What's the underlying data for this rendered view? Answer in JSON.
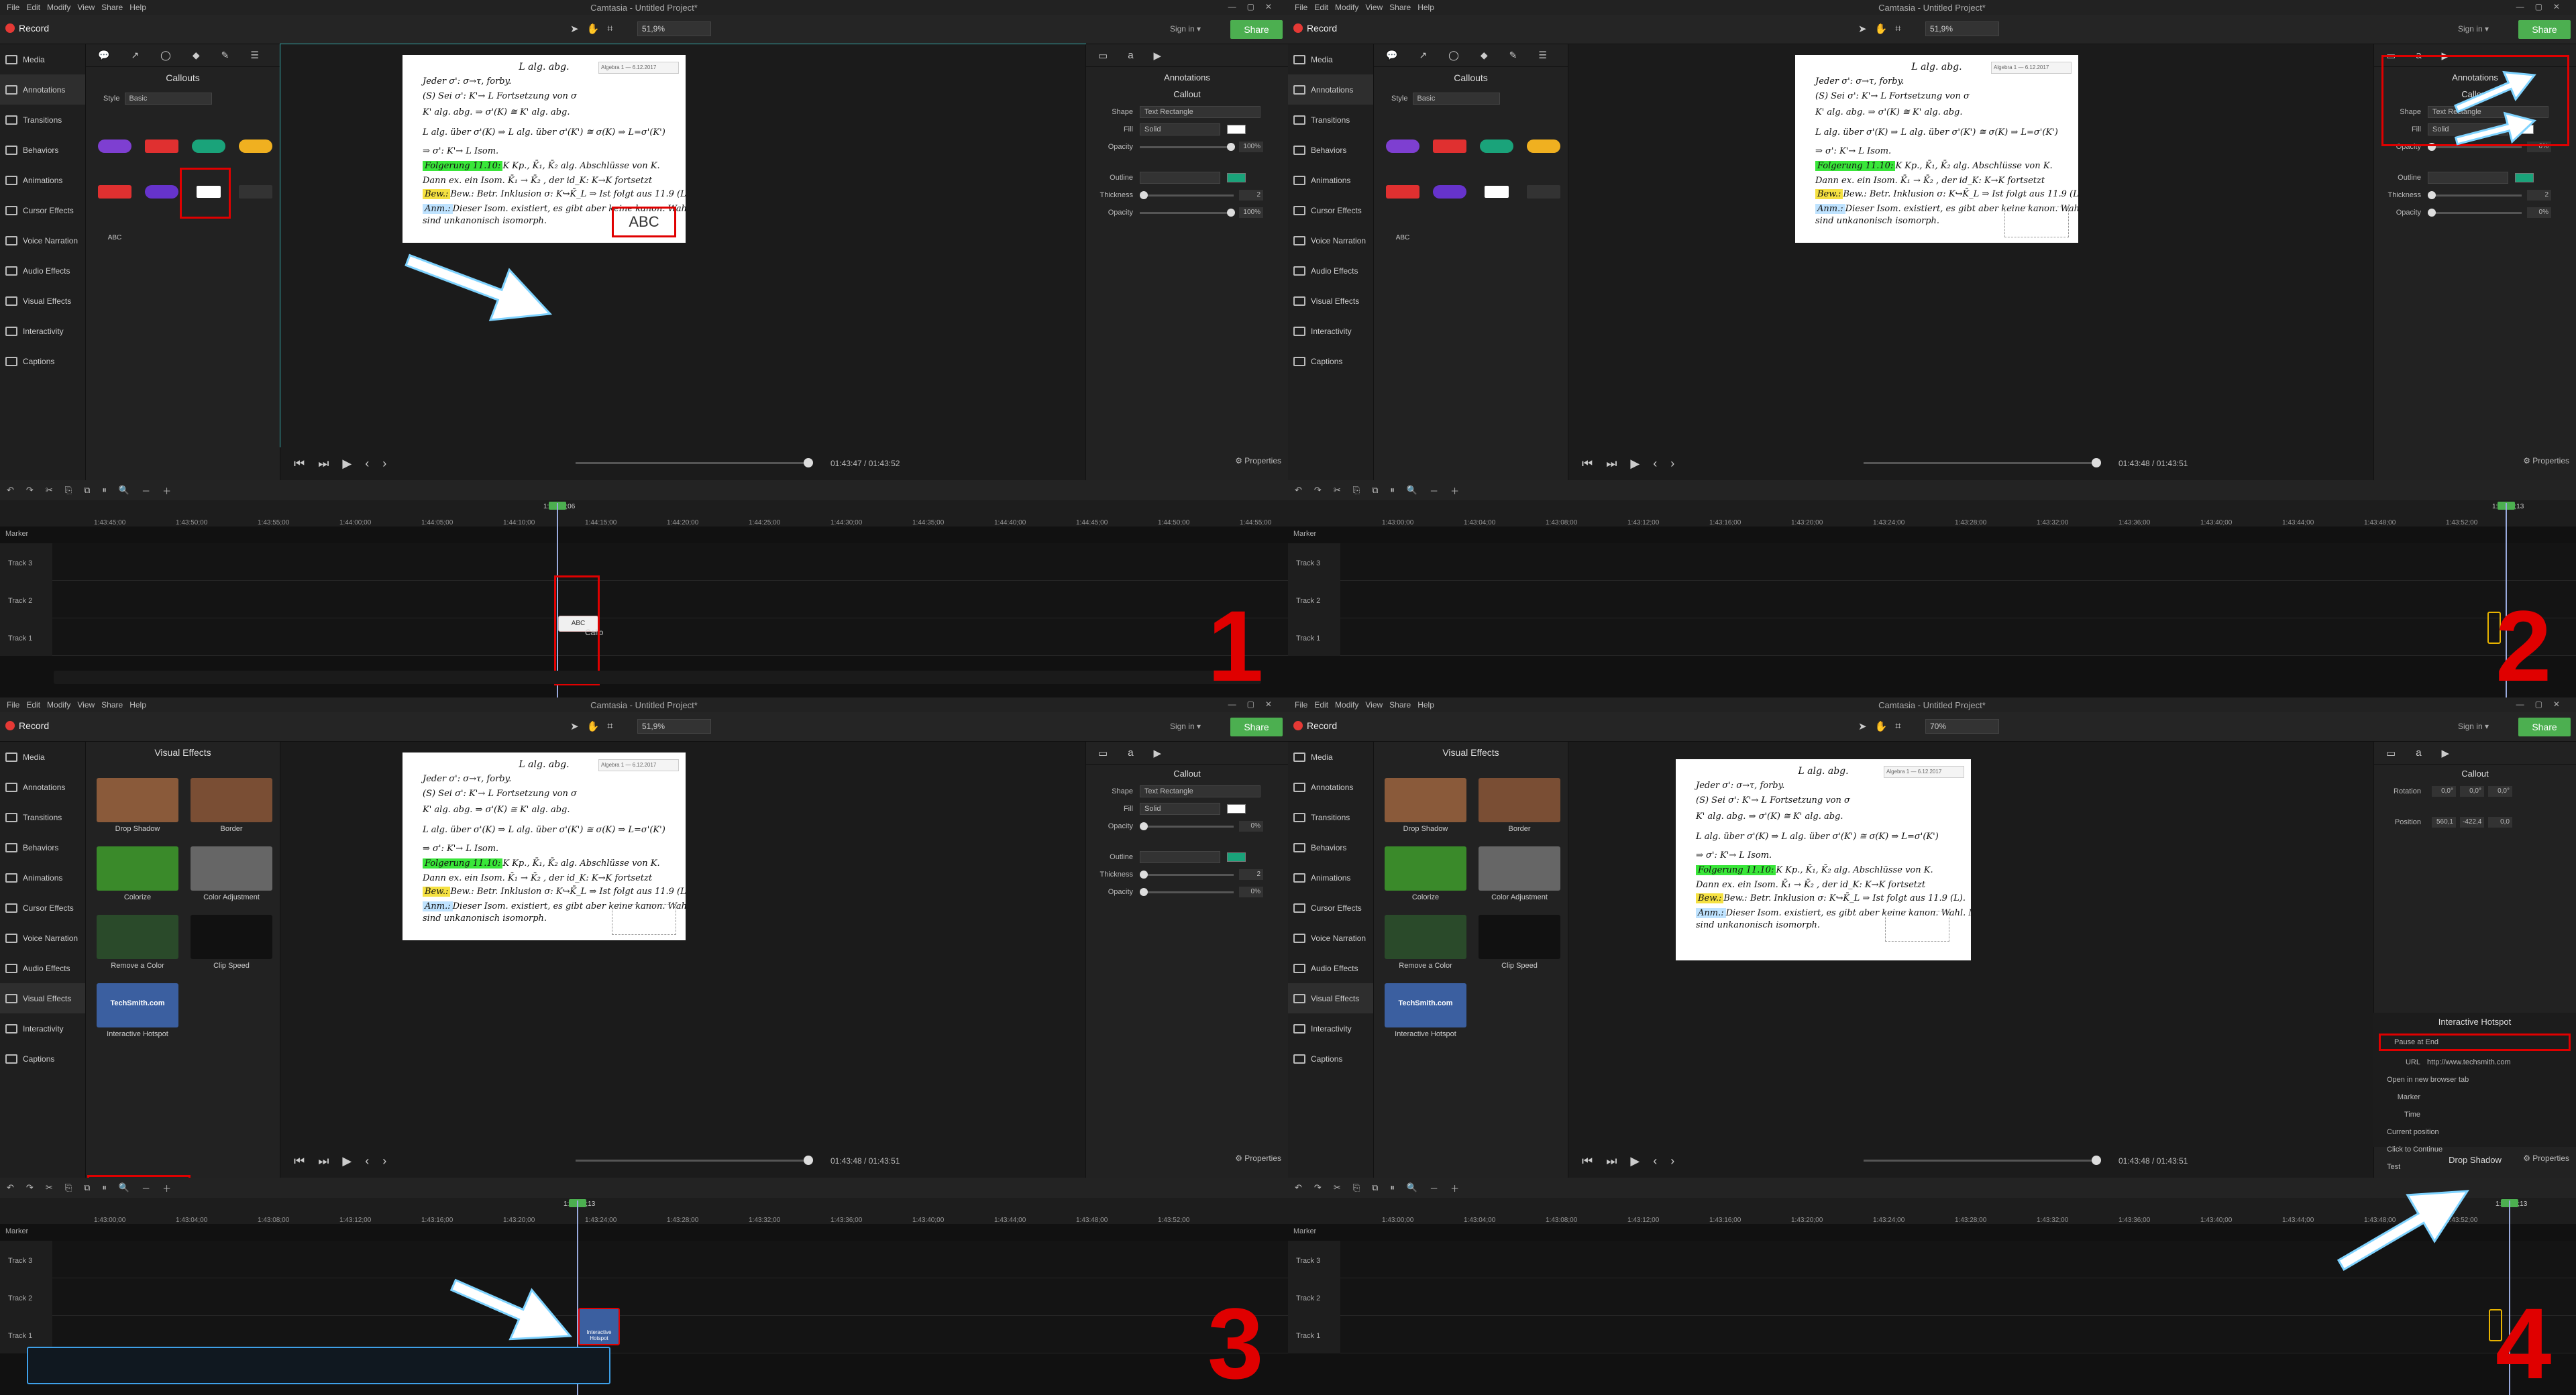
{
  "app": {
    "menu": [
      "File",
      "Edit",
      "Modify",
      "View",
      "Share",
      "Help"
    ],
    "title": "Camtasia - Untitled Project*",
    "record_label": "Record",
    "sign_in": "Sign in ▾",
    "share_label": "Share"
  },
  "sidebar_items": [
    "Media",
    "Annotations",
    "Transitions",
    "Behaviors",
    "Animations",
    "Cursor Effects",
    "Voice Narration",
    "Audio Effects",
    "Visual Effects",
    "Interactivity",
    "Captions"
  ],
  "quadrants": [
    {
      "number": "1",
      "zoom": "51,9%",
      "tray_title": "Callouts",
      "style_label": "Style",
      "style_value": "Basic",
      "props_header": "Annotations",
      "props_title": "Callout",
      "shape_label": "Shape",
      "shape_value": "Text Rectangle",
      "fill_label": "Fill",
      "fill_value": "Solid",
      "opacity_label": "Opacity",
      "opacity_value": "100%",
      "outline_label": "Outline",
      "thickness_label": "Thickness",
      "thickness_value": "2",
      "opacity2_value": "100%",
      "time": "01:43:47 / 01:43:52",
      "playhead": "1:43:47;06",
      "callout_text": "ABC",
      "track_clip_label": "Callo",
      "abc_canvas": "ABC"
    },
    {
      "number": "2",
      "zoom": "51,9%",
      "tray_title": "Callouts",
      "style_label": "Style",
      "style_value": "Basic",
      "props_header": "Annotations",
      "props_title": "Callout",
      "shape_label": "Shape",
      "shape_value": "Text Rectangle",
      "fill_label": "Fill",
      "fill_value": "Solid",
      "opacity_label": "Opacity",
      "opacity_value": "0%",
      "outline_label": "Outline",
      "thickness_label": "Thickness",
      "thickness_value": "2",
      "opacity2_value": "0%",
      "time": "01:43:48 / 01:43:51",
      "playhead": "1:43:48;13"
    },
    {
      "number": "3",
      "zoom": "51,9%",
      "tray_title": "Visual Effects",
      "props_title": "Callout",
      "shape_label": "Shape",
      "shape_value": "Text Rectangle",
      "fill_label": "Fill",
      "fill_value": "Solid",
      "opacity_label": "Opacity",
      "opacity_value": "0%",
      "outline_label": "Outline",
      "thickness_label": "Thickness",
      "thickness_value": "2",
      "opacity2_value": "0%",
      "time": "01:43:48 / 01:43:51",
      "playhead": "1:43:48;13",
      "hotspot_clip_label": "Interactive Hotspot"
    },
    {
      "number": "4",
      "zoom": "70%",
      "tray_title": "Visual Effects",
      "props_title": "Callout",
      "rotation_label": "Rotation",
      "position_label": "Position",
      "rot_values": [
        "0,0°",
        "0,0°",
        "0,0°"
      ],
      "pos_values": [
        "560,1",
        "-422,4",
        "0,0"
      ],
      "hotspot_title": "Interactive Hotspot",
      "pause_at_end": "Pause at End",
      "url_label": "URL",
      "url_value": "http://www.techsmith.com",
      "open_new_tab": "Open in new browser tab",
      "marker_label": "Marker",
      "time_label": "Time",
      "current_position": "Current position",
      "click_to_continue": "Click to Continue",
      "test_label": "Test",
      "drop_shadow": "Drop Shadow",
      "time": "01:43:48 / 01:43:51",
      "playhead": "1:43:48;13"
    }
  ],
  "callout_tray": {
    "abc_label": "ABC"
  },
  "visual_effects": [
    {
      "label": "Drop Shadow",
      "color": "#8a5a3a"
    },
    {
      "label": "Border",
      "color": "#7a4e34"
    },
    {
      "label": "Colorize",
      "color": "#3a8a2a"
    },
    {
      "label": "Color Adjustment",
      "color": "#666666"
    },
    {
      "label": "Remove a Color",
      "color": "#2a4a2a"
    },
    {
      "label": "Clip Speed",
      "color": "#eeeeee"
    },
    {
      "label": "Interactive Hotspot",
      "color": "#3b5fa0"
    }
  ],
  "hotspot_thumb_text": "TechSmith.com",
  "document": {
    "head": "L alg. abg.",
    "lines": [
      "Jeder σ': σ→τ, forby.",
      "(S)  Sei σ': K'→ L Fortsetzung von σ",
      "K' alg. abg.  ⇒  σ'(K) ≅ K'  alg. abg.",
      "L alg. über σ'(K) ⇒ L alg. über σ'(K') ≅ σ(K)  ⇒  L=σ'(K')",
      "⇒ σ': K'→ L Isom.",
      "K  Kp., K̄₁, K̄₂ alg. Abschlüsse von K.",
      "Dann ex. ein Isom.  K̄₁ → K̄₂ , der id_K: K→K fortsetzt",
      "Bew.:  Betr. Inklusion σ: K↪K̄_L ⇒ Ist folgt aus 11.9 (L).",
      "Dieser Isom. existiert, es gibt aber keine kanon. Wahl. Man sagt: K̄₁, K̄₂",
      "sind unkanonisch isomorph."
    ],
    "label_folg": "Folgerung 11.10:",
    "label_bew": "Bew.:",
    "label_anm": "Anm.:",
    "tab_text": "Algebra 1 — 6.12.2017"
  },
  "timeline": {
    "ticks_q1": [
      "1:43:45;00",
      "1:43:50;00",
      "1:43:55;00",
      "1:44:00;00",
      "1:44:05;00",
      "1:44:10;00",
      "1:44:15;00",
      "1:44:20;00",
      "1:44:25;00",
      "1:44:30;00",
      "1:44:35;00",
      "1:44:40;00",
      "1:44:45;00",
      "1:44:50;00",
      "1:44:55;00"
    ],
    "ticks_q2": [
      "1:43:00;00",
      "1:43:04;00",
      "1:43:08;00",
      "1:43:12;00",
      "1:43:16;00",
      "1:43:20;00",
      "1:43:24;00",
      "1:43:28;00",
      "1:43:32;00",
      "1:43:36;00",
      "1:43:40;00",
      "1:43:44;00",
      "1:43:48;00",
      "1:43:52;00"
    ],
    "marker": "Marker",
    "tracks": [
      "Track 3",
      "Track 2",
      "Track 1"
    ]
  },
  "colors": {
    "accent": "#4caf50",
    "red": "#e00000",
    "highlight_green": "#39e639",
    "highlight_yellow": "#f5e142",
    "highlight_blue": "#bfe3ff"
  }
}
